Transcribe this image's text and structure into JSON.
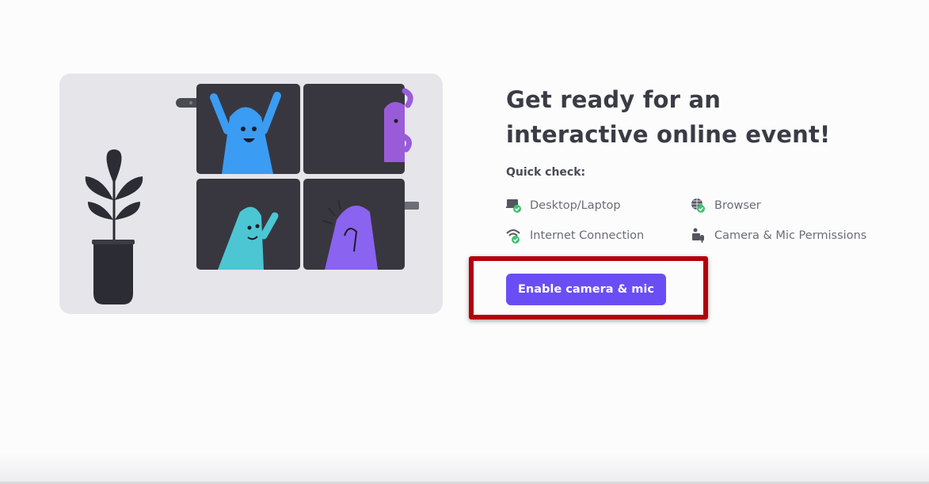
{
  "headline": "Get ready for an interactive online event!",
  "quick_check": {
    "title": "Quick check:",
    "items": [
      {
        "label": "Desktop/Laptop",
        "icon": "laptop-check-icon"
      },
      {
        "label": "Browser",
        "icon": "globe-check-icon"
      },
      {
        "label": "Internet Connection",
        "icon": "wifi-check-icon"
      },
      {
        "label": "Camera & Mic Permissions",
        "icon": "camera-mic-icon"
      }
    ]
  },
  "enable_button": {
    "label": "Enable camera & mic"
  },
  "colors": {
    "accent": "#6b4df5",
    "check_green": "#3cc46e",
    "highlight_red": "#b3000d",
    "tile_dark": "#38373f"
  }
}
